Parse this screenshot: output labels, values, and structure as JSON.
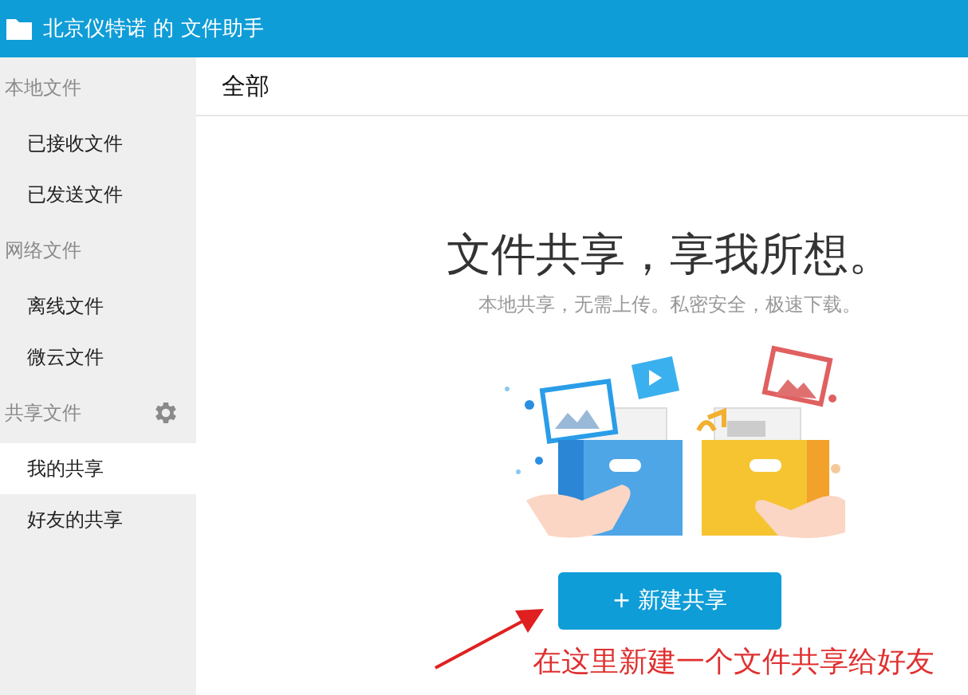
{
  "window": {
    "title": "北京仪特诺 的 文件助手"
  },
  "sidebar": {
    "sections": [
      {
        "title": "本地文件",
        "settings": false,
        "items": [
          {
            "label": "已接收文件",
            "selected": false
          },
          {
            "label": "已发送文件",
            "selected": false
          }
        ]
      },
      {
        "title": "网络文件",
        "settings": false,
        "items": [
          {
            "label": "离线文件",
            "selected": false
          },
          {
            "label": "微云文件",
            "selected": false
          }
        ]
      },
      {
        "title": "共享文件",
        "settings": true,
        "items": [
          {
            "label": "我的共享",
            "selected": true
          },
          {
            "label": "好友的共享",
            "selected": false
          }
        ]
      }
    ]
  },
  "main": {
    "header": "全部",
    "headline": "文件共享，享我所想。",
    "subtitle": "本地共享，无需上传。私密安全，极速下载。",
    "button": "+ 新建共享"
  },
  "annotation": {
    "text": "在这里新建一个文件共享给好友"
  }
}
